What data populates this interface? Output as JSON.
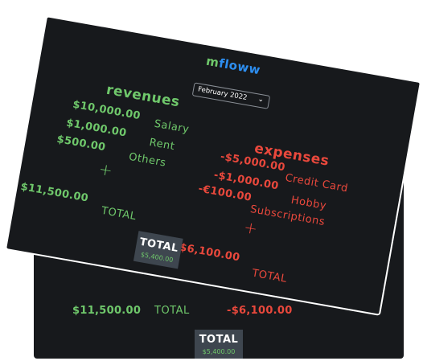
{
  "app": {
    "logo_m": "m",
    "logo_rest": "floww"
  },
  "month_select": {
    "selected": "February 2022"
  },
  "revenues": {
    "title": "revenues",
    "items": [
      {
        "amount": "$10,000.00",
        "label": "Salary"
      },
      {
        "amount": "$1,000.00",
        "label": "Rent"
      },
      {
        "amount": "$500.00",
        "label": "Others"
      }
    ],
    "add_symbol": "+",
    "total_amount": "$11,500.00",
    "total_label": "TOTAL"
  },
  "expenses": {
    "title": "expenses",
    "items": [
      {
        "amount": "-$5,000.00",
        "label": "Credit Card"
      },
      {
        "amount": "-$1,000.00",
        "label": "Hobby"
      },
      {
        "amount": "-€100.00",
        "label": "Subscriptions"
      }
    ],
    "add_symbol": "+",
    "total_amount": "-$6,100.00",
    "total_label": "TOTAL"
  },
  "grand_total": {
    "label": "TOTAL",
    "value": "$5,400.00"
  },
  "colors": {
    "background": "#17191c",
    "positive": "#6fc86b",
    "negative": "#e9483c",
    "brand_blue": "#2d8ef0",
    "total_box": "#3e464f"
  }
}
